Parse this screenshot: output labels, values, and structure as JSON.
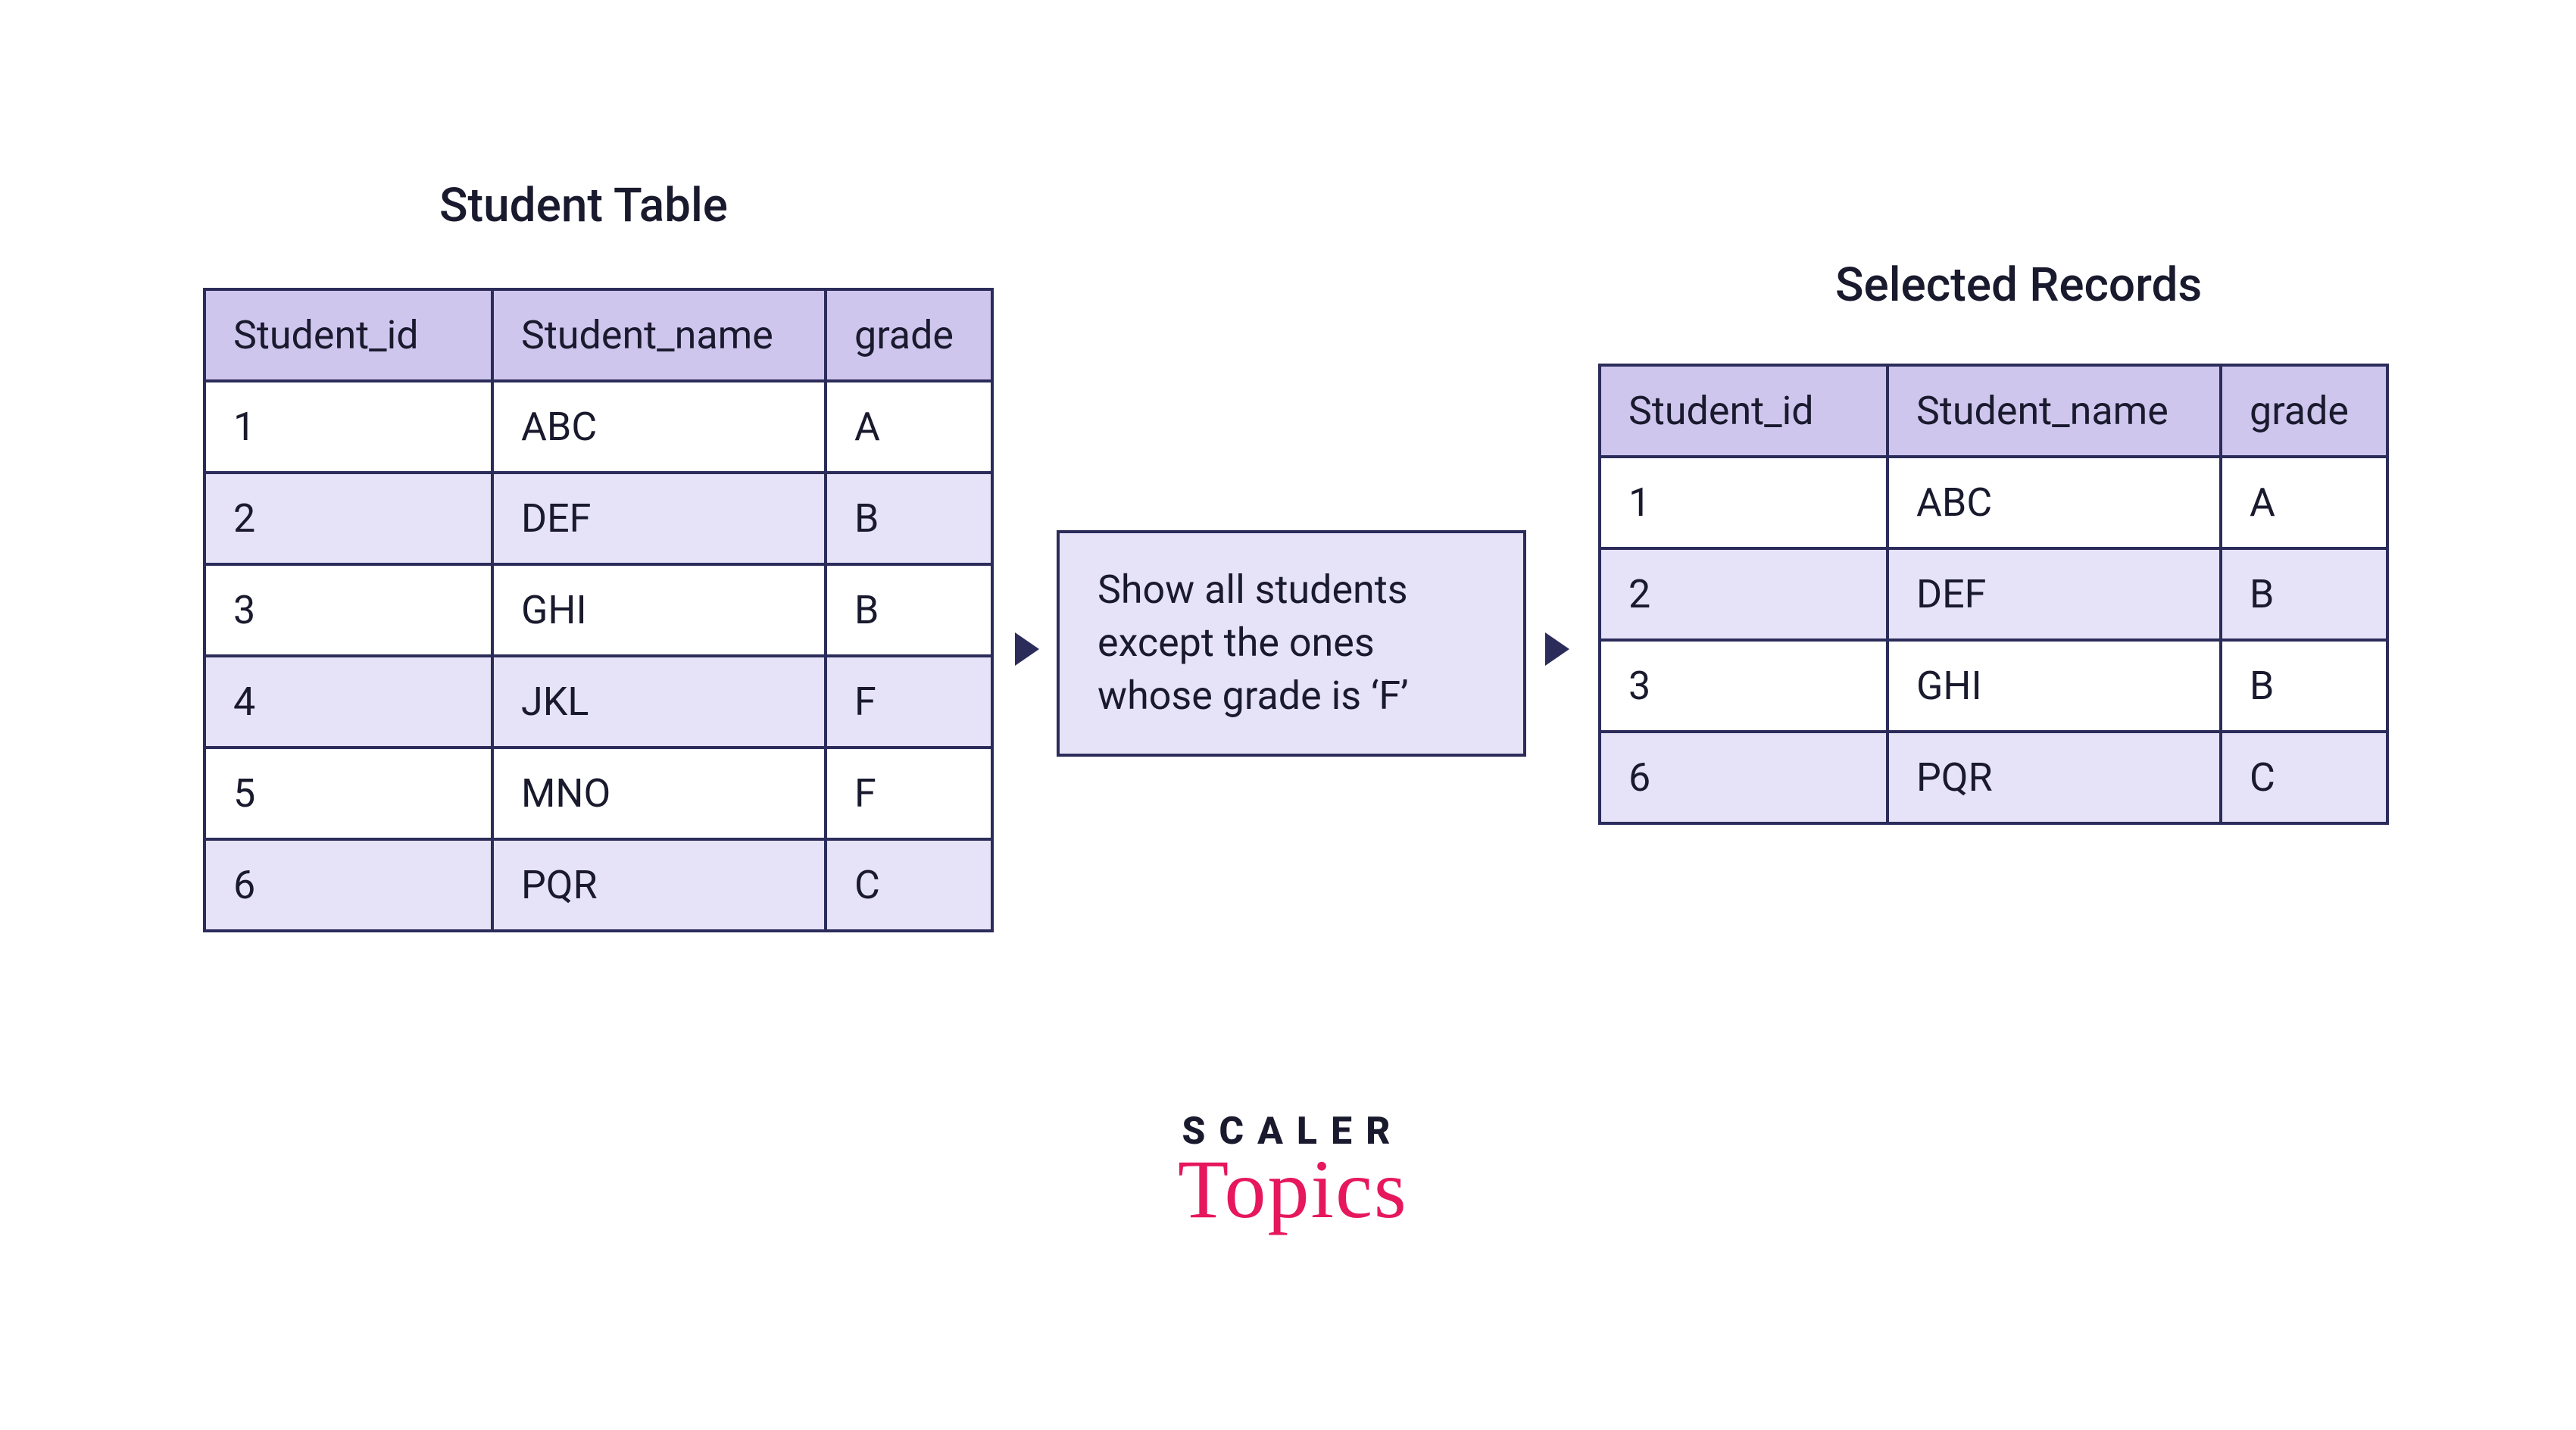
{
  "left_table": {
    "title": "Student Table",
    "headers": [
      "Student_id",
      "Student_name",
      "grade"
    ],
    "rows": [
      [
        "1",
        "ABC",
        "A"
      ],
      [
        "2",
        "DEF",
        "B"
      ],
      [
        "3",
        "GHI",
        "B"
      ],
      [
        "4",
        "JKL",
        "F"
      ],
      [
        "5",
        "MNO",
        "F"
      ],
      [
        "6",
        "PQR",
        "C"
      ]
    ]
  },
  "right_table": {
    "title": "Selected Records",
    "headers": [
      "Student_id",
      "Student_name",
      "grade"
    ],
    "rows": [
      [
        "1",
        "ABC",
        "A"
      ],
      [
        "2",
        "DEF",
        "B"
      ],
      [
        "3",
        "GHI",
        "B"
      ],
      [
        "6",
        "PQR",
        "C"
      ]
    ]
  },
  "filter_text": "Show all students except the ones whose grade is ‘F’",
  "logo": {
    "top": "SCALER",
    "bottom": "Topics"
  },
  "colors": {
    "border": "#2c2c5a",
    "header_bg": "#cfc6ee",
    "row_alt_bg": "#e6e2f7",
    "accent": "#e6175c"
  }
}
